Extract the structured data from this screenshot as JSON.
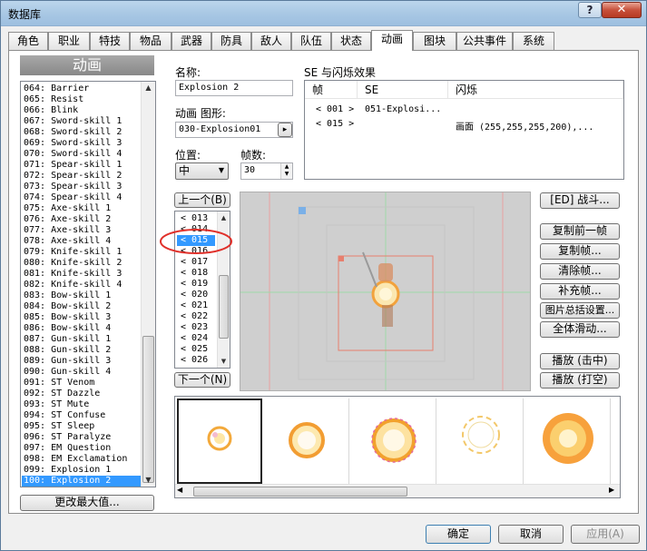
{
  "window": {
    "title": "数据库",
    "help_label": "?",
    "close_label": "✕"
  },
  "tabs": [
    {
      "label": "角色",
      "active": false
    },
    {
      "label": "职业",
      "active": false
    },
    {
      "label": "特技",
      "active": false
    },
    {
      "label": "物品",
      "active": false
    },
    {
      "label": "武器",
      "active": false
    },
    {
      "label": "防具",
      "active": false
    },
    {
      "label": "敌人",
      "active": false
    },
    {
      "label": "队伍",
      "active": false
    },
    {
      "label": "状态",
      "active": false
    },
    {
      "label": "动画",
      "active": true
    },
    {
      "label": "图块",
      "active": false
    },
    {
      "label": "公共事件",
      "active": false
    },
    {
      "label": "系统",
      "active": false
    }
  ],
  "sidebar": {
    "heading": "动画",
    "items": [
      "064: Barrier",
      "065: Resist",
      "066: Blink",
      "067: Sword-skill 1",
      "068: Sword-skill 2",
      "069: Sword-skill 3",
      "070: Sword-skill 4",
      "071: Spear-skill 1",
      "072: Spear-skill 2",
      "073: Spear-skill 3",
      "074: Spear-skill 4",
      "075: Axe-skill 1",
      "076: Axe-skill 2",
      "077: Axe-skill 3",
      "078: Axe-skill 4",
      "079: Knife-skill 1",
      "080: Knife-skill 2",
      "081: Knife-skill 3",
      "082: Knife-skill 4",
      "083: Bow-skill 1",
      "084: Bow-skill 2",
      "085: Bow-skill 3",
      "086: Bow-skill 4",
      "087: Gun-skill 1",
      "088: Gun-skill 2",
      "089: Gun-skill 3",
      "090: Gun-skill 4",
      "091: ST Venom",
      "092: ST Dazzle",
      "093: ST Mute",
      "094: ST Confuse",
      "095: ST Sleep",
      "096: ST Paralyze",
      "097: EM Question",
      "098: EM Exclamation",
      "099: Explosion 1",
      "100: Explosion 2"
    ],
    "selected_index": 36,
    "change_max_label": "更改最大值..."
  },
  "form": {
    "name_label": "名称:",
    "name_value": "Explosion 2",
    "graphic_label": "动画 图形:",
    "graphic_value": "030-Explosion01",
    "graphic_button": "▸",
    "position_label": "位置:",
    "position_value": "中",
    "frames_label": "帧数:",
    "frames_value": "30"
  },
  "se_panel": {
    "title": "SE 与闪烁效果",
    "columns": [
      "帧",
      "SE",
      "闪烁"
    ],
    "rows": [
      {
        "frame": "< 001 >",
        "se": "051-Explosi...",
        "flash": ""
      },
      {
        "frame": "< 015 >",
        "se": "",
        "flash": "画面 (255,255,255,200),..."
      }
    ]
  },
  "frame_nav": {
    "prev_label": "上一个(B)",
    "next_label": "下一个(N)",
    "frames": [
      "< 013",
      "< 014",
      "< 015",
      "< 016",
      "< 017",
      "< 018",
      "< 019",
      "< 020",
      "< 021",
      "< 022",
      "< 023",
      "< 024",
      "< 025",
      "< 026"
    ],
    "selected_index": 2
  },
  "right_buttons": {
    "battle": "[ED] 战斗...",
    "copy_prev": "复制前一帧",
    "copy_frames": "复制帧...",
    "clear_frames": "清除帧...",
    "fill_frames": "补充帧...",
    "batch_cell": "图片总括设置...",
    "slide_all": "全体滑动...",
    "play_hit": "播放 (击中)",
    "play_miss": "播放 (打空)"
  },
  "bottom_buttons": {
    "ok": "确定",
    "cancel": "取消",
    "apply": "应用(A)"
  },
  "colors": {
    "selection": "#3399ff",
    "annotation_circle": "#e0302a",
    "canvas": "#cfcfcf"
  }
}
